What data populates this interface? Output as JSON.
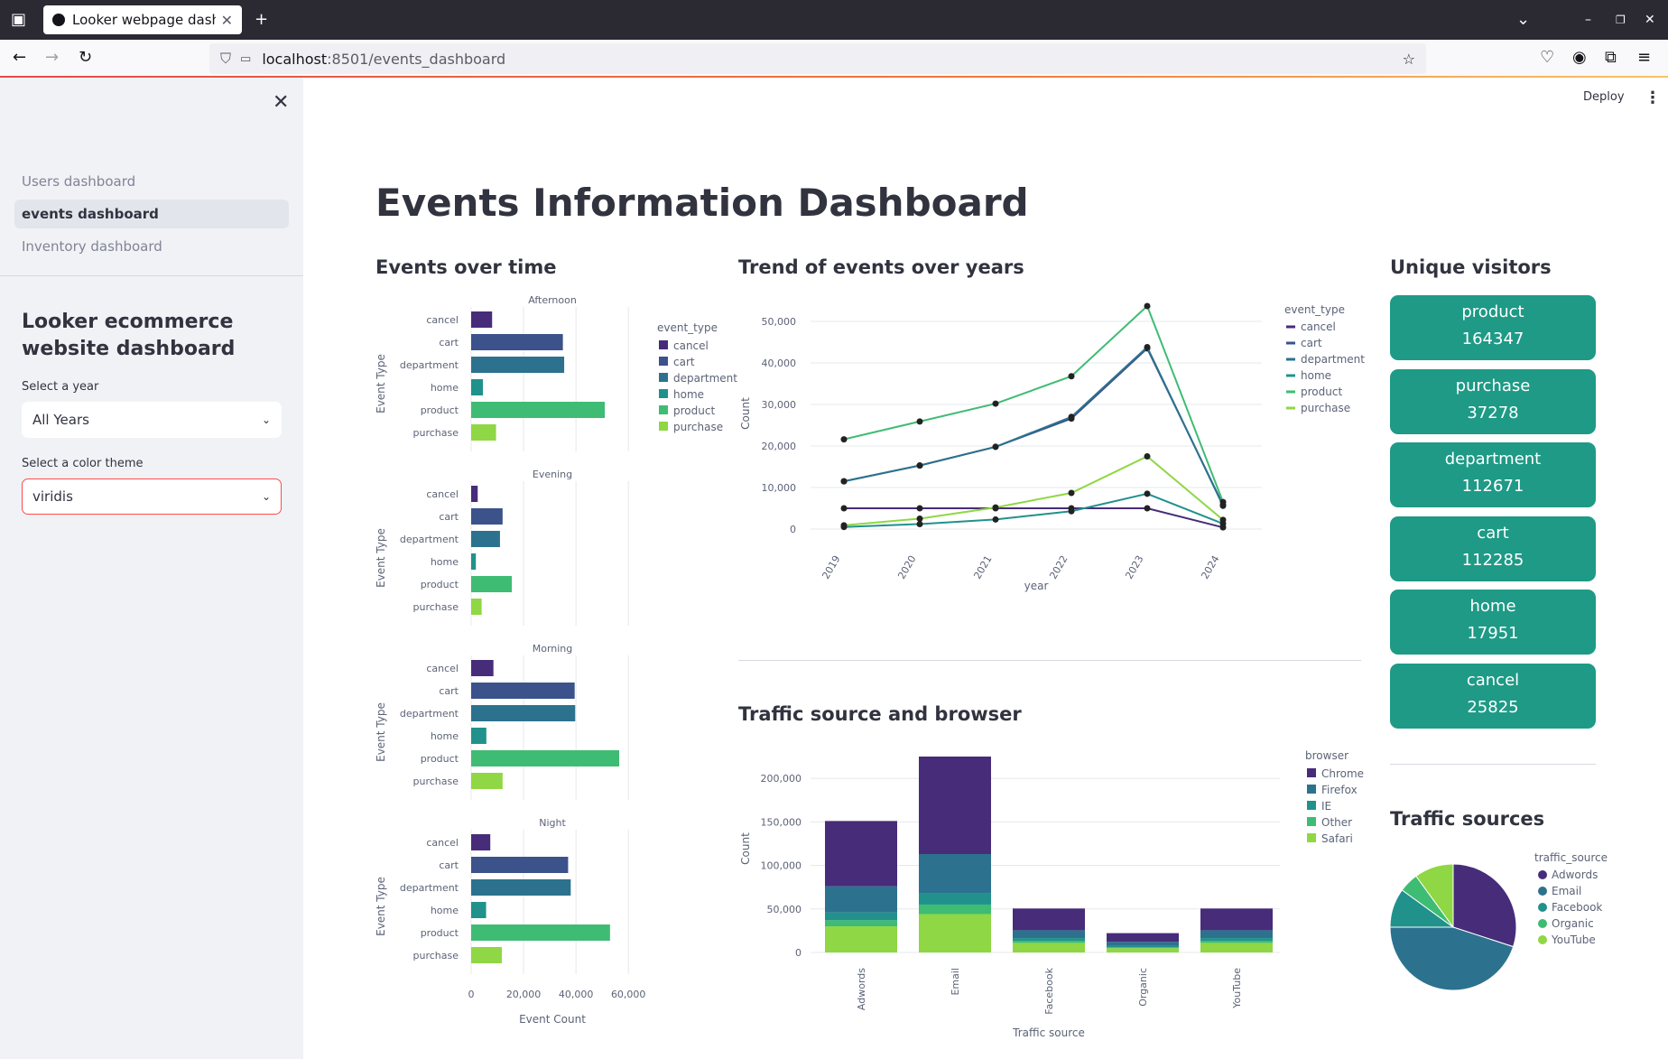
{
  "browser": {
    "tab_title": "Looker webpage dashbo",
    "url_host": "localhost",
    "url_path": ":8501/events_dashboard"
  },
  "sidebar": {
    "nav": [
      "Users dashboard",
      "events dashboard",
      "Inventory dashboard"
    ],
    "active_index": 1,
    "heading": "Looker ecommerce website dashboard",
    "year_label": "Select a year",
    "year_value": "All Years",
    "theme_label": "Select a color theme",
    "theme_value": "viridis"
  },
  "header": {
    "deploy_label": "Deploy"
  },
  "page_title": "Events Information Dashboard",
  "sections": {
    "events_over_time": "Events over time",
    "trend": "Trend of events over years",
    "unique_visitors": "Unique visitors",
    "traffic_browser": "Traffic source and browser",
    "traffic_sources": "Traffic sources"
  },
  "colors": {
    "cancel": "#472c7a",
    "cart": "#3b528b",
    "department": "#2c728e",
    "home": "#21918c",
    "product": "#3fbc73",
    "purchase": "#8fd744",
    "metric_bg": "#1e9a86"
  },
  "metrics": [
    {
      "label": "product",
      "value": "164347"
    },
    {
      "label": "purchase",
      "value": "37278"
    },
    {
      "label": "department",
      "value": "112671"
    },
    {
      "label": "cart",
      "value": "112285"
    },
    {
      "label": "home",
      "value": "17951"
    },
    {
      "label": "cancel",
      "value": "25825"
    }
  ],
  "chart_data": [
    {
      "type": "bar",
      "orientation": "horizontal",
      "facets": [
        "Afternoon",
        "Evening",
        "Morning",
        "Night"
      ],
      "categories": [
        "cancel",
        "cart",
        "department",
        "home",
        "product",
        "purchase"
      ],
      "series": [
        {
          "facet": "Afternoon",
          "values": [
            8000,
            35000,
            35500,
            4500,
            51000,
            9500
          ]
        },
        {
          "facet": "Evening",
          "values": [
            2500,
            12000,
            11000,
            1800,
            15500,
            4000
          ]
        },
        {
          "facet": "Morning",
          "values": [
            8500,
            39500,
            39700,
            5800,
            56500,
            12000
          ]
        },
        {
          "facet": "Night",
          "values": [
            7300,
            37000,
            38000,
            5700,
            53000,
            11700
          ]
        }
      ],
      "xlabel": "Event Count",
      "ylabel": "Event Type",
      "xticks": [
        "0",
        "20,000",
        "40,000",
        "60,000"
      ],
      "xlim": [
        0,
        62000
      ],
      "legend_title": "event_type",
      "legend": [
        "cancel",
        "cart",
        "department",
        "home",
        "product",
        "purchase"
      ]
    },
    {
      "type": "line",
      "x": [
        "2019",
        "2020",
        "2021",
        "2022",
        "2023",
        "2024"
      ],
      "series": [
        {
          "name": "cancel",
          "values": [
            5000,
            5000,
            5000,
            5000,
            5000,
            400
          ]
        },
        {
          "name": "cart",
          "values": [
            11500,
            15300,
            19800,
            26600,
            43500,
            5800
          ]
        },
        {
          "name": "department",
          "values": [
            11500,
            15300,
            19800,
            27000,
            43800,
            5600
          ]
        },
        {
          "name": "home",
          "values": [
            500,
            1200,
            2300,
            4300,
            8500,
            1300
          ]
        },
        {
          "name": "product",
          "values": [
            21600,
            25900,
            30200,
            36800,
            53700,
            6500
          ]
        },
        {
          "name": "purchase",
          "values": [
            900,
            2500,
            5200,
            8700,
            17500,
            2200
          ]
        }
      ],
      "xlabel": "year",
      "ylabel": "Count",
      "yticks": [
        "0",
        "10,000",
        "20,000",
        "30,000",
        "40,000",
        "50,000"
      ],
      "ylim": [
        0,
        55000
      ],
      "legend_title": "event_type"
    },
    {
      "type": "bar",
      "stacked": true,
      "categories": [
        "Adwords",
        "Email",
        "Facebook",
        "Organic",
        "YouTube"
      ],
      "series": [
        {
          "name": "Chrome",
          "color": "#472c7a",
          "values": [
            75000,
            112000,
            25000,
            10000,
            25000
          ]
        },
        {
          "name": "Firefox",
          "color": "#2c728e",
          "values": [
            30000,
            45000,
            9000,
            4500,
            9000
          ]
        },
        {
          "name": "IE",
          "color": "#21918c",
          "values": [
            9000,
            13000,
            3000,
            1500,
            3000
          ]
        },
        {
          "name": "Other",
          "color": "#3fbc73",
          "values": [
            7000,
            11000,
            2500,
            1200,
            2500
          ]
        },
        {
          "name": "Safari",
          "color": "#8fd744",
          "values": [
            30000,
            44000,
            11000,
            5000,
            11000
          ]
        }
      ],
      "xlabel": "Traffic source",
      "ylabel": "Count",
      "yticks": [
        "0",
        "50,000",
        "100,000",
        "150,000",
        "200,000"
      ],
      "ylim": [
        0,
        225000
      ],
      "legend_title": "browser"
    },
    {
      "type": "pie",
      "categories": [
        "Adwords",
        "Email",
        "Facebook",
        "Organic",
        "YouTube"
      ],
      "values": [
        30,
        45,
        10,
        5,
        10
      ],
      "colors": [
        "#472c7a",
        "#2c728e",
        "#21918c",
        "#3fbc73",
        "#8fd744"
      ],
      "legend_title": "traffic_source"
    }
  ]
}
